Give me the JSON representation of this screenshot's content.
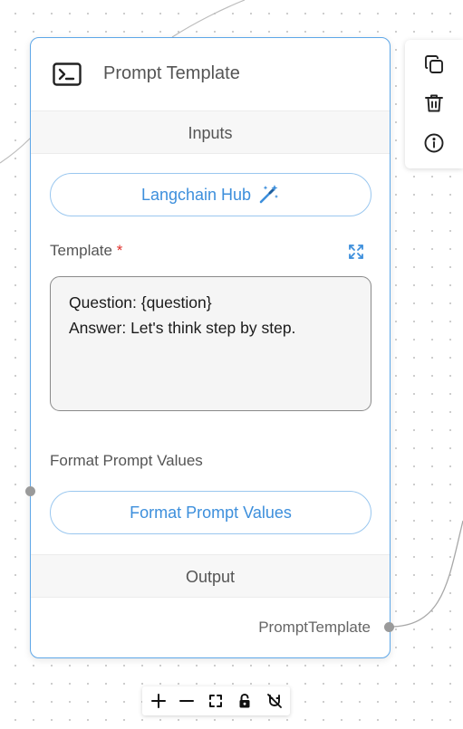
{
  "node": {
    "title": "Prompt Template",
    "icon": "terminal-icon",
    "inputs_section_label": "Inputs",
    "langchain_hub_button": "Langchain Hub",
    "template_field": {
      "label": "Template",
      "required_marker": "*",
      "lines": [
        "Question: {question}",
        "Answer: Let's think step by step."
      ]
    },
    "format_prompt_values_label": "Format Prompt Values",
    "format_prompt_values_button": "Format Prompt Values",
    "output_section_label": "Output",
    "output_label": "PromptTemplate"
  },
  "side_toolbar": {
    "icons": [
      "copy-icon",
      "trash-icon",
      "info-icon"
    ]
  },
  "zoom_controls": {
    "icons": [
      "plus-icon",
      "minus-icon",
      "fit-view-icon",
      "lock-icon",
      "magnet-icon"
    ]
  },
  "colors": {
    "accent": "#3d8fdc",
    "node_border": "#5ea7e8",
    "required": "#e0302b",
    "section_bg": "#f7f7f7",
    "canvas_dots": "#c9c9c9"
  }
}
